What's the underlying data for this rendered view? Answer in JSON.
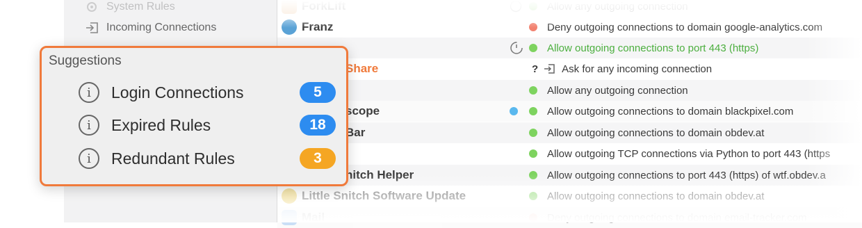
{
  "sidebar": {
    "items": [
      {
        "label": "System Rules",
        "icon": "gear-icon"
      },
      {
        "label": "Incoming Connections",
        "icon": "incoming-arrow-icon"
      }
    ]
  },
  "rules_table": {
    "rows": [
      {
        "app": "ForkLift",
        "rule": "Allow any outgoing connection",
        "status": "allow",
        "marker": "pending-icon"
      },
      {
        "app": "Franz",
        "rule": "Deny outgoing connections to domain google-analytics.com",
        "status": "deny"
      },
      {
        "app": "",
        "rule": "Allow outgoing connections to port 443 (https)",
        "status": "allow",
        "marker": "timer-icon",
        "rule_color": "#4caf3f"
      },
      {
        "app": "Share",
        "rule": "Ask for any incoming connection",
        "status": "ask",
        "app_color": "#f07a3b"
      },
      {
        "app": "",
        "rule": "Allow any outgoing connection",
        "status": "allow"
      },
      {
        "app": "scope",
        "rule": "Allow outgoing connections to domain blackpixel.com",
        "status": "allow",
        "marker": "blue-dot"
      },
      {
        "app": "Bar",
        "rule": "Allow outgoing connections to domain obdev.at",
        "status": "allow"
      },
      {
        "app": "",
        "rule": "Allow outgoing TCP connections via Python to port 443 (https",
        "status": "allow"
      },
      {
        "app": "nitch Helper",
        "rule": "Allow outgoing connections to port 443 (https) of wtf.obdev.a",
        "status": "allow"
      },
      {
        "app": "Little Snitch Software Update",
        "rule": "Allow outgoing connections to domain obdev.at",
        "status": "allow"
      },
      {
        "app": "Mail",
        "rule": "Deny outgoing connections to domain email-tracker.com",
        "status": "deny"
      }
    ]
  },
  "suggestions": {
    "title": "Suggestions",
    "items": [
      {
        "label": "Login Connections",
        "count": "5",
        "color": "#2d8cf0"
      },
      {
        "label": "Expired Rules",
        "count": "18",
        "color": "#2d8cf0"
      },
      {
        "label": "Redundant Rules",
        "count": "3",
        "color": "#f5a623"
      }
    ]
  },
  "colors": {
    "accent": "#f07a3b",
    "allow": "#7ed35f",
    "deny": "#f2816f",
    "blue": "#2d8cf0"
  }
}
